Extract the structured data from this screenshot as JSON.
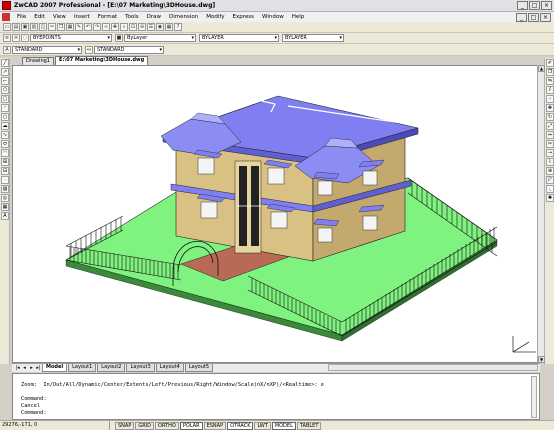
{
  "app_title": "ZwCAD 2007 Professional - [E:\\07 Marketing\\3DHouse.dwg]",
  "window_buttons": [
    "_",
    "□",
    "×"
  ],
  "menu": [
    "File",
    "Edit",
    "View",
    "Insert",
    "Format",
    "Tools",
    "Draw",
    "Dimension",
    "Modify",
    "Express",
    "Window",
    "Help"
  ],
  "layer_dropdown": "BYEPOINTS",
  "linetype_dropdown": "ByLayer",
  "linetype2_dropdown": "BYLAYER",
  "lineweight_dropdown": "BYLAYER",
  "text_style_dropdown": "STANDARD",
  "dim_style_dropdown": "STANDARD",
  "doc_tabs": [
    "Drawing1",
    "E:\\07 Marketing\\3DHouse.dwg"
  ],
  "layout_tabs": [
    "Model",
    "Layout1",
    "Layout2",
    "Layout3",
    "Layout4",
    "Layout5"
  ],
  "command_lines": [
    "",
    "Zoom:  In/Out/All/Dynamic/Center/Extents/Left/Previous/Right/Window/Scale(nX/nXP)/<Realtime>: e",
    "",
    "Command:",
    "Cancel",
    "Command:"
  ],
  "coords": "29276,-171, 0",
  "status_buttons": [
    {
      "label": "SNAP",
      "on": false
    },
    {
      "label": "GRID",
      "on": false
    },
    {
      "label": "ORTHO",
      "on": false
    },
    {
      "label": "POLAR",
      "on": true
    },
    {
      "label": "ESNAP",
      "on": false
    },
    {
      "label": "OTRACK",
      "on": true
    },
    {
      "label": "LWT",
      "on": false
    },
    {
      "label": "MODEL",
      "on": true
    },
    {
      "label": "TABLET",
      "on": false
    }
  ],
  "colors": {
    "wall": "#d9c184",
    "roof": "#7f7ff2",
    "lawn": "#7ff27f",
    "path": "#b86a55",
    "fence": "#111111"
  }
}
